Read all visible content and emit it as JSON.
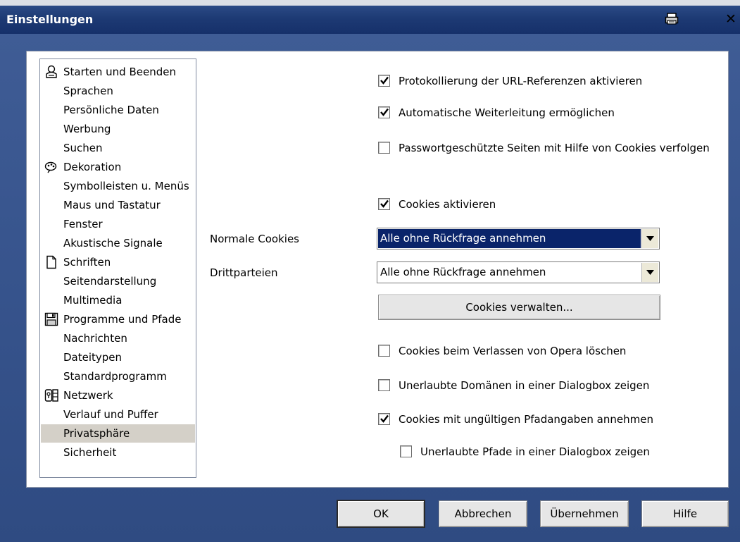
{
  "window": {
    "title": "Einstellungen"
  },
  "sidebar": {
    "items": [
      {
        "label": "Starten und Beenden",
        "icon": "power-person-icon"
      },
      {
        "label": "Sprachen"
      },
      {
        "label": "Persönliche Daten"
      },
      {
        "label": "Werbung"
      },
      {
        "label": "Suchen"
      },
      {
        "label": "Dekoration",
        "icon": "decoration-icon"
      },
      {
        "label": "Symbolleisten u. Menüs"
      },
      {
        "label": "Maus und Tastatur"
      },
      {
        "label": "Fenster"
      },
      {
        "label": "Akustische Signale"
      },
      {
        "label": "Schriften",
        "icon": "document-icon"
      },
      {
        "label": "Seitendarstellung"
      },
      {
        "label": "Multimedia"
      },
      {
        "label": "Programme und Pfade",
        "icon": "floppy-disk-icon"
      },
      {
        "label": "Nachrichten"
      },
      {
        "label": "Dateitypen"
      },
      {
        "label": "Standardprogramm"
      },
      {
        "label": "Netzwerk",
        "icon": "network-lock-icon"
      },
      {
        "label": "Verlauf und Puffer"
      },
      {
        "label": "Privatsphäre",
        "selected": true
      },
      {
        "label": "Sicherheit"
      }
    ]
  },
  "options": {
    "log_referrers": {
      "label": "Protokollierung der URL-Referenzen aktivieren",
      "checked": true
    },
    "auto_redirect": {
      "label": "Automatische Weiterleitung ermöglichen",
      "checked": true
    },
    "password_cookies": {
      "label": "Passwortgeschützte Seiten mit Hilfe von Cookies verfolgen",
      "checked": false
    },
    "enable_cookies": {
      "label": "Cookies aktivieren",
      "checked": true
    },
    "normal_cookies": {
      "label": "Normale Cookies",
      "value": "Alle ohne Rückfrage annehmen"
    },
    "third_party": {
      "label": "Drittparteien",
      "value": "Alle ohne Rückfrage annehmen"
    },
    "manage_cookies_button": "Cookies verwalten...",
    "delete_on_exit": {
      "label": "Cookies beim Verlassen von Opera löschen",
      "checked": false
    },
    "show_forbidden_domains": {
      "label": "Unerlaubte Domänen in einer Dialogbox zeigen",
      "checked": false
    },
    "accept_invalid_paths": {
      "label": "Cookies mit ungültigen Pfadangaben annehmen",
      "checked": true
    },
    "show_forbidden_paths": {
      "label": "Unerlaubte Pfade in einer Dialogbox zeigen",
      "checked": false
    }
  },
  "footer": {
    "ok": "OK",
    "cancel": "Abbrechen",
    "apply": "Übernehmen",
    "help": "Hilfe"
  },
  "colors": {
    "titlebar": "#1d3a74",
    "frame": "#38558e",
    "selection": "#0a246a",
    "tree_selected": "#d4d0c8"
  }
}
